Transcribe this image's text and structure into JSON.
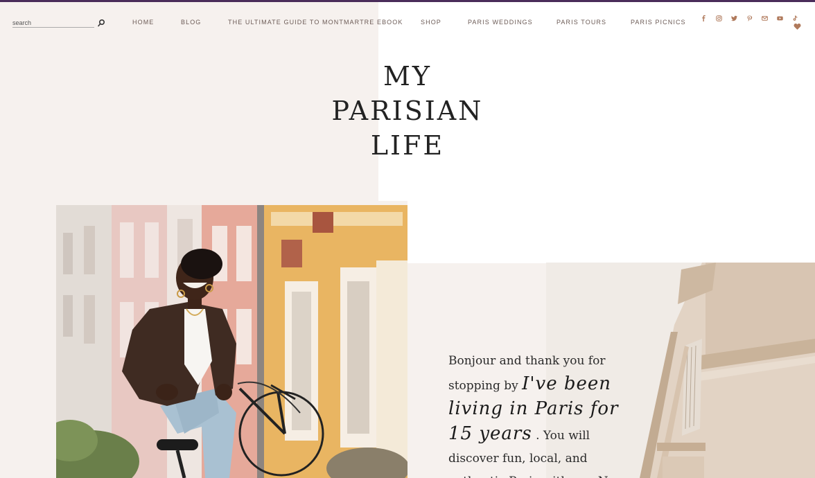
{
  "search": {
    "placeholder": "search"
  },
  "nav": {
    "items": [
      {
        "label": "HOME"
      },
      {
        "label": "BLOG"
      },
      {
        "label": "THE ULTIMATE GUIDE TO MONTMARTRE EBOOK"
      },
      {
        "label": "SHOP"
      },
      {
        "label": "PARIS WEDDINGS"
      },
      {
        "label": "PARIS TOURS"
      },
      {
        "label": "PARIS PICNICS"
      }
    ]
  },
  "social": {
    "icons": [
      "facebook-icon",
      "instagram-icon",
      "twitter-icon",
      "pinterest-icon",
      "email-icon",
      "youtube-icon",
      "tiktok-icon",
      "heart-icon"
    ],
    "color": "#b07a5c"
  },
  "title": {
    "line1": "MY",
    "line2": "PARISIAN",
    "line3": "LIFE"
  },
  "intro": {
    "text1": "Bonjour and thank you for stopping by",
    "script": "I've been living in Paris for 15 years",
    "text2": ". You will discover fun, local, and authentic Paris with me. No"
  },
  "colors": {
    "accent": "#b07a5c",
    "background_beige": "#f6f1ee",
    "top_border": "#4a2c5a"
  }
}
